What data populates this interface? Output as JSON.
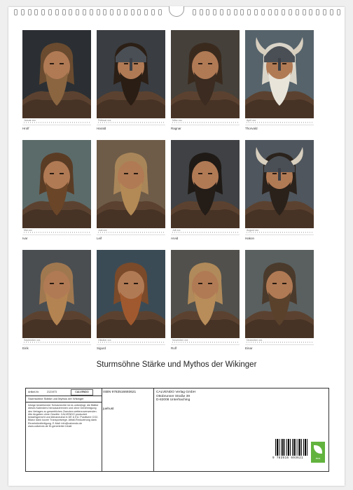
{
  "calendar": {
    "title": "Sturmsöhne Stärke und Mythos der Wikinger",
    "months": [
      {
        "name": "Hrolf",
        "month": "Januar xxx"
      },
      {
        "name": "Harald",
        "month": "Februar xxx"
      },
      {
        "name": "Ragnar",
        "month": "März xxx"
      },
      {
        "name": "Thorvald",
        "month": "April xxx"
      },
      {
        "name": "Ivar",
        "month": "Mai xxx"
      },
      {
        "name": "Leif",
        "month": "Juni xxx"
      },
      {
        "name": "Arvid",
        "month": "Juli xxx"
      },
      {
        "name": "Hakon",
        "month": "August xxx"
      },
      {
        "name": "Eirik",
        "month": "September xxx"
      },
      {
        "name": "Sigurd",
        "month": "Oktober xxx"
      },
      {
        "name": "Rolf",
        "month": "November xxx"
      },
      {
        "name": "Einar",
        "month": "Dezember xxx"
      }
    ]
  },
  "info": {
    "artikel_label": "Artikel-Nr.",
    "artikel_nr": "2121973",
    "logo_text": "CALVENDO",
    "short_title": "Sturmsöhne Stärke und Mythos der Wikinger",
    "legal_text": "Infolge bestehender Schutzrechte ist es unbedingt, die Blätter dieses Kalenders herauszutrennen und ohne Genehmigung des Verlages zu gewerblichen Zwecken weiterzuverwenden. Alle Angaben ohne Gewähr. CALVENDO produziert bedarfsgerecht und klimaneutral in DE & EU. Positivere CO2-Bilanz dank kurzer Transportwege. Abfall-Reduzierung dank Einzelstückfertigung. E-Mail: info@calvendo.de www.calvendo.de KI-generierter Inhalt",
    "isbn": "ISBN 9783516693621",
    "author": "juehust",
    "publisher": [
      "CALVENDO Verlag GmbH",
      "Ottobrunner Straße 39",
      "D-82008 Unterhaching"
    ],
    "barcode_digits": "9 783516 693621",
    "eco_label": "eco"
  },
  "colors": {
    "fur_brown": "#6b4a2f",
    "skin": "#b07a55",
    "helmet_steel": "#4a4f55",
    "eco_green": "#62b33e"
  }
}
